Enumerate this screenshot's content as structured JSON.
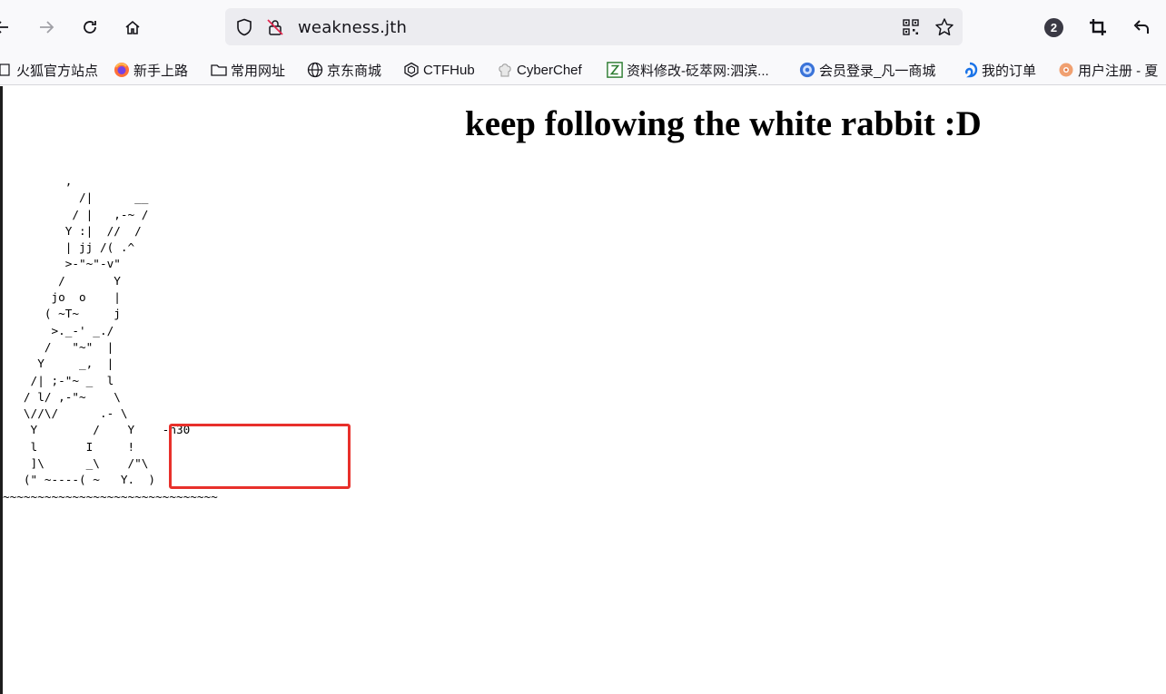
{
  "browser": {
    "url": "weakness.jth",
    "badge_count": "2",
    "nav_icons": [
      "back-arrow-icon",
      "forward-arrow-icon",
      "reload-icon",
      "home-icon"
    ],
    "url_icons": [
      "shield-icon",
      "insecure-lock-icon",
      "qr-code-icon",
      "star-icon"
    ],
    "toolbar_icons": [
      "account-badge-icon",
      "crop-icon",
      "undo-icon"
    ],
    "bookmarks": [
      {
        "label": "火狐官方站点",
        "icon": "page-icon"
      },
      {
        "label": "新手上路",
        "icon": "firefox-icon"
      },
      {
        "label": "常用网址",
        "icon": "folder-icon"
      },
      {
        "label": "京东商城",
        "icon": "globe-icon"
      },
      {
        "label": "CTFHub",
        "icon": "ctfhub-icon"
      },
      {
        "label": "CyberChef",
        "icon": "chef-hat-icon"
      },
      {
        "label": "资料修改-砭萃网:泗滨...",
        "icon": "site-icon"
      },
      {
        "label": "会员登录_凡一商城",
        "icon": "circle-icon"
      },
      {
        "label": "我的订单",
        "icon": "swirl-icon"
      },
      {
        "label": "用户注册 - 夏",
        "icon": "flower-icon"
      }
    ]
  },
  "page": {
    "heading": "keep following the white rabbit :D",
    "ascii_art": "         ,\n           /|      __\n          / |   ,-~ /\n         Y :|  //  /\n         | jj /( .^\n         >-\"~\"-v\"\n        /       Y\n       jo  o    |\n      ( ~T~     j\n       >._-' _./\n      /   \"~\"  |\n     Y     _,  |\n    /| ;-\"~ _  l\n   / l/ ,-\"~    \\\n   \\//\\/      .- \\\n    Y        /    Y    -n30\n    l       I     !\n    ]\\      _\\    /\"\\\n   (\" ~----( ~   Y.  )\n~~~~~~~~~~~~~~~~~~~~~~~~~~~~~~~",
    "colors": {
      "highlight": "#e8302b",
      "text": "#000000",
      "toolbar": "#f9f9fb",
      "urlbar": "#ececf0"
    }
  }
}
